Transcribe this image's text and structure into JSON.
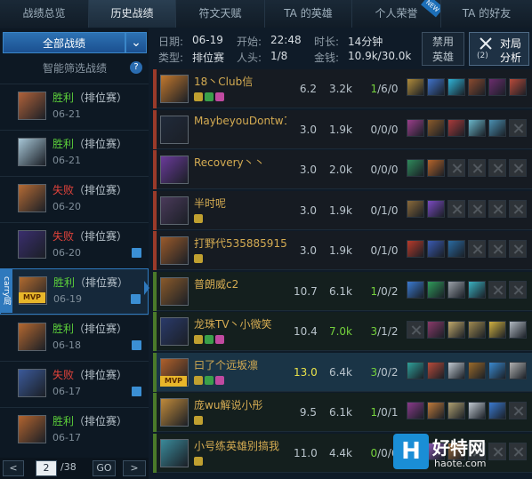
{
  "tabs": [
    {
      "label": "战绩总览"
    },
    {
      "label": "历史战绩"
    },
    {
      "label": "符文天赋"
    },
    {
      "label": "TA 的英雄"
    },
    {
      "label": "个人荣誉",
      "badge": "NEW"
    },
    {
      "label": "TA 的好友"
    }
  ],
  "sidebar": {
    "filter_label": "全部战绩",
    "smart_filter": "智能筛选战绩",
    "help": "?",
    "carry_label": "carry局",
    "matches": [
      {
        "result": "胜利",
        "mode": "（排位赛）",
        "date": "06-21",
        "won": true,
        "color": "#b0623a"
      },
      {
        "result": "胜利",
        "mode": "（排位赛）",
        "date": "06-21",
        "won": true,
        "color": "#a7c6d6"
      },
      {
        "result": "失败",
        "mode": "（排位赛）",
        "date": "06-20",
        "won": false,
        "color": "#b56b35"
      },
      {
        "result": "失败",
        "mode": "（排位赛）",
        "date": "06-20",
        "won": false,
        "color": "#3a2e6e"
      },
      {
        "result": "胜利",
        "mode": "（排位赛）",
        "date": "06-19",
        "won": true,
        "color": "#b06a2f",
        "mvp": "MVP"
      },
      {
        "result": "胜利",
        "mode": "（排位赛）",
        "date": "06-18",
        "won": true,
        "color": "#b46830"
      },
      {
        "result": "失败",
        "mode": "（排位赛）",
        "date": "06-17",
        "won": false,
        "color": "#3b5a9a"
      },
      {
        "result": "胜利",
        "mode": "（排位赛）",
        "date": "06-17",
        "won": true,
        "color": "#b2642f"
      }
    ]
  },
  "pager": {
    "prev": "<",
    "page": "2",
    "total": "/38",
    "go": "GO",
    "next": ">"
  },
  "info": {
    "date_label": "日期:",
    "date": "06-19",
    "start_label": "开始:",
    "start": "22:48",
    "duration_label": "时长:",
    "duration": "14分钟",
    "type_label": "类型:",
    "type": "排位赛",
    "kills_label": "人头:",
    "kills": "1/8",
    "gold_label": "金钱:",
    "gold": "10.9k/30.0k",
    "ban_line1": "禁用",
    "ban_line2": "英雄",
    "vs_line1": "对局",
    "vs_line2": "分析",
    "vs_count": "(2)"
  },
  "players": [
    {
      "name": "18丶Club信",
      "score": "6.2",
      "gold": "3.2k",
      "k": "1",
      "da": "/6/0",
      "team": 1,
      "color": "#c2782d",
      "items": [
        "#b08b3a",
        "#3f72c9",
        "#2fb3d6",
        "#8a4a2f",
        "#6b2d6d",
        "#b84a3a"
      ]
    },
    {
      "name": "MaybeyouDontw1n",
      "score": "3.0",
      "gold": "1.9k",
      "k": "0",
      "da": "/0/0",
      "team": 1,
      "color": "#202a3a",
      "items": [
        "#9a3e8a",
        "#8a5a2a",
        "#a93a3a",
        "#6ab5c9",
        "#4a8fb0",
        "empty"
      ]
    },
    {
      "name": "Recovery丶丶",
      "score": "3.0",
      "gold": "2.0k",
      "k": "0",
      "da": "/0/0",
      "team": 1,
      "color": "#6a3a9a",
      "items": [
        "#2f8a5a",
        "#b5642a",
        "empty",
        "empty",
        "empty",
        "empty"
      ]
    },
    {
      "name": "半时呢",
      "score": "3.0",
      "gold": "1.9k",
      "k": "0",
      "da": "/1/0",
      "team": 1,
      "color": "#4a3a5a",
      "items": [
        "#8a6a3a",
        "#7a4ac0",
        "empty",
        "empty",
        "empty",
        "empty"
      ]
    },
    {
      "name": "打野代535885915",
      "score": "3.0",
      "gold": "1.9k",
      "k": "0",
      "da": "/1/0",
      "team": 1,
      "color": "#9a5a2a",
      "items": [
        "#b83a2a",
        "#3a5ab0",
        "#2a6aa0",
        "empty",
        "empty",
        "empty"
      ]
    },
    {
      "name": "普朗威c2",
      "score": "10.7",
      "gold": "6.1k",
      "k": "1",
      "da": "/0/2",
      "team": 2,
      "color": "#8a5a2a",
      "items": [
        "#3a7ad0",
        "#2f9a5a",
        "#9aa0a8",
        "#3ab0c0",
        "empty",
        "empty"
      ]
    },
    {
      "name": "龙珠TV丶小微笑",
      "score": "10.4",
      "gold": "7.0k",
      "k": "3",
      "da": "/1/2",
      "team": 2,
      "color": "#2a3a6a",
      "gold_color": "green",
      "items": [
        "empty",
        "#8a3a6a",
        "#c0a86a",
        "#a08a50",
        "#d0b040",
        "#b0b8c0"
      ]
    },
    {
      "name": "曰了个远坂凛",
      "score": "13.0",
      "gold": "6.4k",
      "k": "3",
      "da": "/0/2",
      "team": 2,
      "color": "#b0602a",
      "highlight": true,
      "mvp": "MVP",
      "score_color": "yellow",
      "items": [
        "#2fa09a",
        "#b84a3a",
        "#c0c8d0",
        "#9a6a2a",
        "#3a8ad0",
        "#b0b0b0"
      ]
    },
    {
      "name": "庞wu解说小彤",
      "score": "9.5",
      "gold": "6.1k",
      "k": "1",
      "da": "/0/1",
      "team": 2,
      "color": "#c08a3a",
      "items": [
        "#8a3a8a",
        "#c07a3a",
        "#b0a070",
        "#c0c8d0",
        "#3a7ad0",
        "empty"
      ]
    },
    {
      "name": "小号练英雄别搞我",
      "score": "11.0",
      "gold": "4.4k",
      "k": "0",
      "da": "/0/6",
      "team": 2,
      "color": "#3a8a9a",
      "items": [
        "#3a9a5a",
        "#8a5ab0",
        "#9a6a3a",
        "empty",
        "empty",
        "empty"
      ]
    }
  ],
  "watermark": {
    "logo": "H",
    "name": "好特网",
    "url": "haote.com"
  }
}
